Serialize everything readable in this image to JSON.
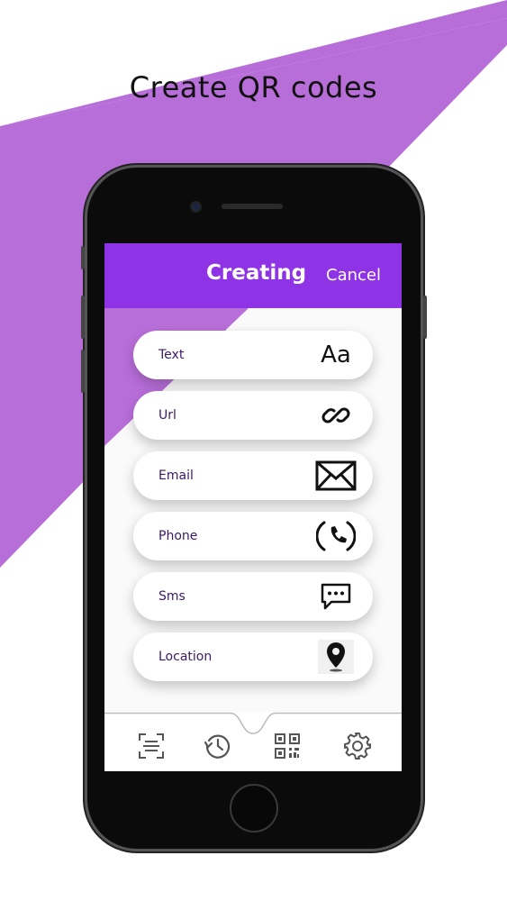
{
  "promo": {
    "title": "Create QR codes"
  },
  "app": {
    "header": {
      "title": "Creating",
      "cancel_label": "Cancel"
    },
    "items": [
      {
        "label": "Text",
        "icon": "text-aa-icon",
        "glyph": "Aa"
      },
      {
        "label": "Url",
        "icon": "link-icon"
      },
      {
        "label": "Email",
        "icon": "envelope-icon"
      },
      {
        "label": "Phone",
        "icon": "phone-icon"
      },
      {
        "label": "Sms",
        "icon": "chat-bubble-icon"
      },
      {
        "label": "Location",
        "icon": "map-pin-icon"
      }
    ],
    "tabs": [
      {
        "name": "scan",
        "icon": "scan-icon"
      },
      {
        "name": "history",
        "icon": "history-icon"
      },
      {
        "name": "create",
        "icon": "qr-code-icon"
      },
      {
        "name": "settings",
        "icon": "gear-icon"
      }
    ]
  },
  "colors": {
    "accent": "#8e33e6",
    "stripe": "#b86ed9",
    "text_dark": "#3a1a66"
  }
}
